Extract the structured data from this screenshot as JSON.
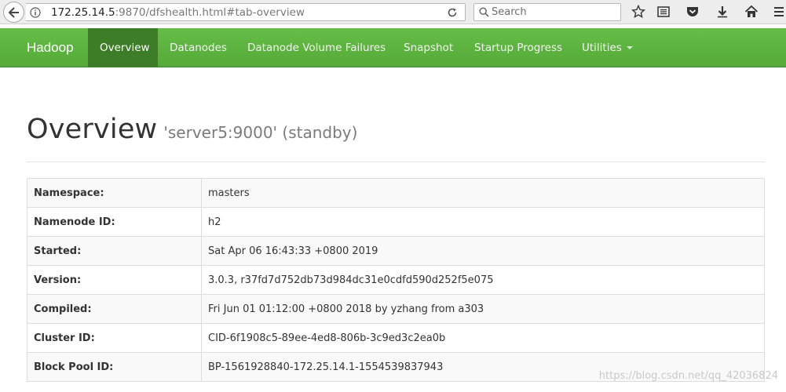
{
  "browser": {
    "url_host": "172.25.14.5",
    "url_rest": ":9870/dfshealth.html#tab-overview",
    "search_placeholder": "Search"
  },
  "navbar": {
    "brand": "Hadoop",
    "items": [
      {
        "label": "Overview",
        "active": true
      },
      {
        "label": "Datanodes"
      },
      {
        "label": "Datanode Volume Failures"
      },
      {
        "label": "Snapshot"
      },
      {
        "label": "Startup Progress"
      },
      {
        "label": "Utilities",
        "dropdown": true
      }
    ]
  },
  "header": {
    "title": "Overview",
    "subtitle": "'server5:9000' (standby)"
  },
  "overview": {
    "rows": [
      {
        "key": "Namespace:",
        "value": "masters"
      },
      {
        "key": "Namenode ID:",
        "value": "h2"
      },
      {
        "key": "Started:",
        "value": "Sat Apr 06 16:43:33 +0800 2019"
      },
      {
        "key": "Version:",
        "value": "3.0.3, r37fd7d752db73d984dc31e0cdfd590d252f5e075"
      },
      {
        "key": "Compiled:",
        "value": "Fri Jun 01 01:12:00 +0800 2018 by yzhang from a303"
      },
      {
        "key": "Cluster ID:",
        "value": "CID-6f1908c5-89ee-4ed8-806b-3c9ed3c2ea0b"
      },
      {
        "key": "Block Pool ID:",
        "value": "BP-1561928840-172.25.14.1-1554539837943"
      }
    ]
  },
  "watermark": "https://blog.csdn.net/qq_42036824",
  "colors": {
    "navbar": "#5cb33e",
    "navbar_active": "#3d7d28"
  }
}
